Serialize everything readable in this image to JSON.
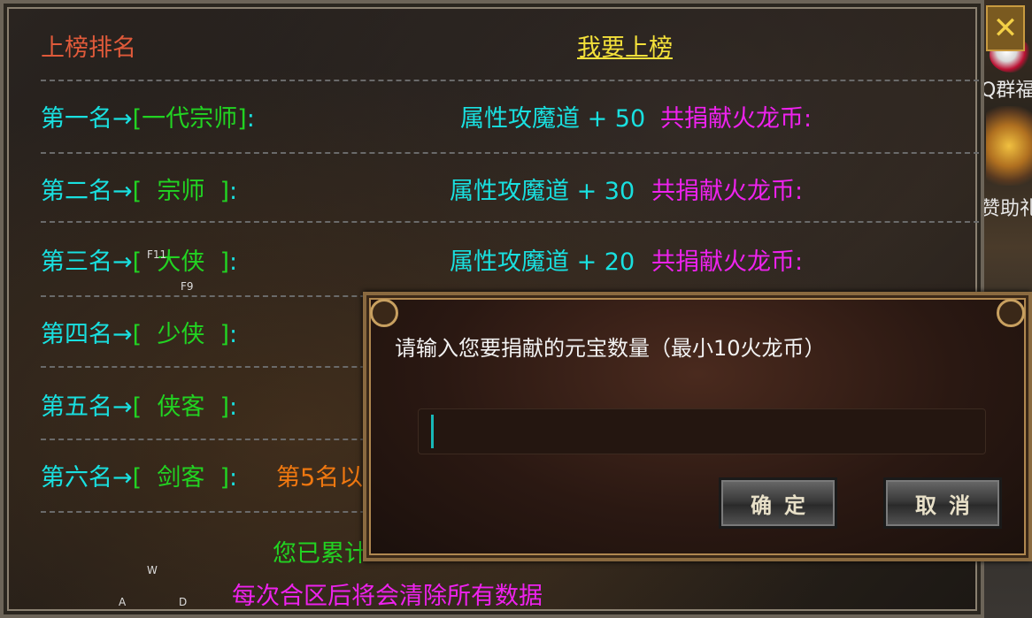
{
  "panel": {
    "header_left": "上榜排名",
    "header_right": "我要上榜",
    "rows": [
      {
        "rank": "第一名→",
        "title": "[一代宗师]",
        "colon": ":",
        "bonus": "属性攻魔道 + 50",
        "donate": "共捐献火龙币:"
      },
      {
        "rank": "第二名→",
        "title": "[  宗师  ]",
        "colon": ":",
        "bonus": "属性攻魔道 + 30",
        "donate": "共捐献火龙币:"
      },
      {
        "rank": "第三名→",
        "title": "[  大侠  ]",
        "colon": ":",
        "bonus": "属性攻魔道 + 20",
        "donate": "共捐献火龙币:"
      },
      {
        "rank": "第四名→",
        "title": "[  少侠  ]",
        "colon": ":"
      },
      {
        "rank": "第五名→",
        "title": "[  侠客  ]",
        "colon": ":"
      },
      {
        "rank": "第六名→",
        "title": "[  剑客  ]",
        "colon": ":",
        "note": "第5名以"
      }
    ],
    "accumulated": "您已累计",
    "footer": "每次合区后将会清除所有数据"
  },
  "hud": {
    "key_f11": "F11",
    "key_f9": "F9",
    "key_w": "W",
    "key_a": "A",
    "key_d": "D"
  },
  "side": {
    "close_label": "✕",
    "text1": "Q群福",
    "text2": "赞助礼"
  },
  "dialog": {
    "title": "请输入您要捐献的元宝数量（最小10火龙币）",
    "input_value": "",
    "confirm_label": "确定",
    "cancel_label": "取消"
  }
}
